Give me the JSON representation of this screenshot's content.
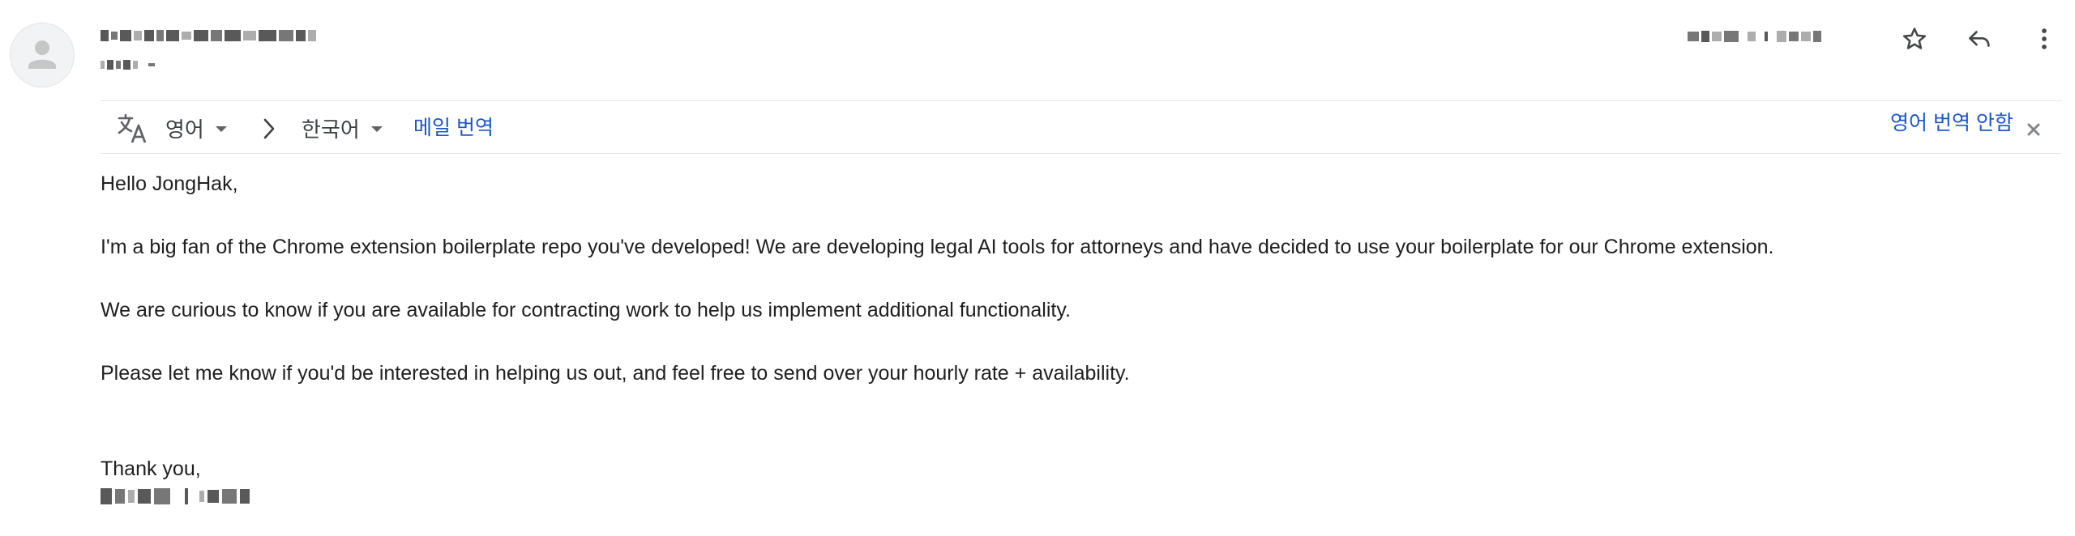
{
  "sender": {
    "name_redacted": true,
    "subline_redacted": true
  },
  "header": {
    "timestamp_redacted": true,
    "star_label": "Star",
    "reply_label": "Reply",
    "more_label": "More"
  },
  "translation_bar": {
    "source_language": "영어",
    "target_language": "한국어",
    "translate_link": "메일 번역",
    "dont_translate_link": "영어 번역 안함"
  },
  "email": {
    "greeting": "Hello JongHak,",
    "paragraphs": [
      "I'm a big fan of the Chrome extension boilerplate repo you've developed! We are developing legal AI tools for attorneys and have decided to use your boilerplate for our Chrome extension.",
      "We are curious to know if you are available for contracting work to help us implement additional functionality.",
      "Please let me know if you'd be interested in helping us out, and feel free to send over your hourly rate + availability."
    ],
    "closing": "Thank you,",
    "signature_redacted": true
  },
  "colors": {
    "link_blue": "#1a57c5",
    "text": "#1f1f1f",
    "icon_gray": "#5f6368",
    "divider": "#e6e6e6"
  },
  "icons": {
    "avatar": "person-icon",
    "star": "star-icon",
    "reply": "reply-icon",
    "more": "more-vert-icon",
    "translate": "translate-icon",
    "arrow": "chevron-right-icon",
    "close": "close-icon"
  }
}
